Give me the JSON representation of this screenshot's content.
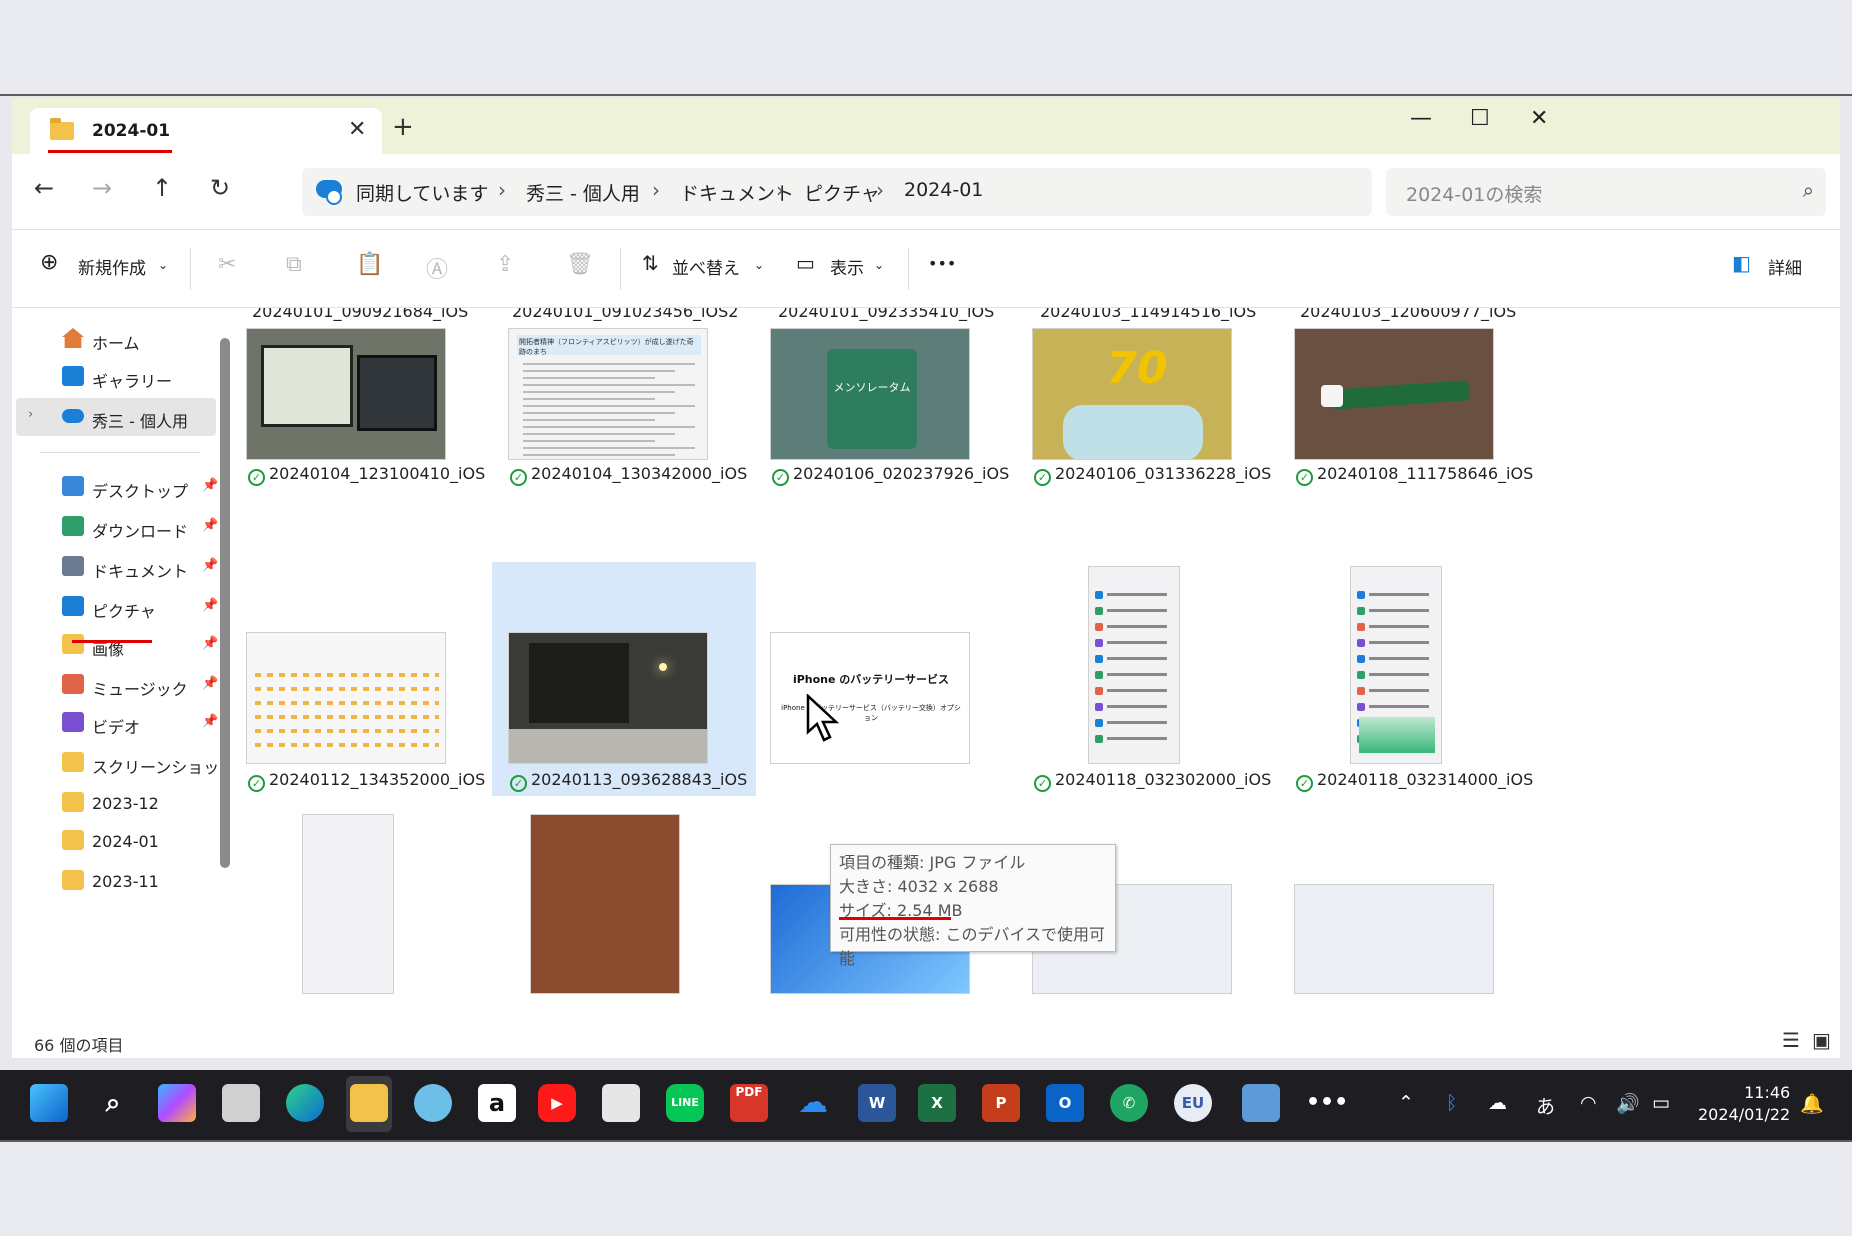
{
  "tab": {
    "title": "2024-01"
  },
  "address": {
    "crumbs": [
      "同期しています",
      "秀三 - 個人用",
      "ドキュメント",
      "ピクチャ",
      "2024-01"
    ]
  },
  "search": {
    "placeholder": "2024-01の検索"
  },
  "toolbar": {
    "new": "新規作成",
    "sort": "並べ替え",
    "view": "表示",
    "details": "詳細",
    "more": "•••"
  },
  "sidebar": {
    "home": "ホーム",
    "gallery": "ギャラリー",
    "onedrive": "秀三 - 個人用",
    "pinned": [
      {
        "label": "デスクトップ",
        "color": "#3a86d9"
      },
      {
        "label": "ダウンロード",
        "color": "#2e9e6a"
      },
      {
        "label": "ドキュメント",
        "color": "#6b7a90"
      },
      {
        "label": "ピクチャ",
        "color": "#1b7fd6"
      },
      {
        "label": "画像",
        "color": "#f3c24a"
      },
      {
        "label": "ミュージック",
        "color": "#e0634a"
      },
      {
        "label": "ビデオ",
        "color": "#7b4fd1"
      },
      {
        "label": "スクリーンショット",
        "color": "#f3c24a"
      },
      {
        "label": "2023-12",
        "color": "#f3c24a"
      },
      {
        "label": "2024-01",
        "color": "#f3c24a"
      },
      {
        "label": "2023-11",
        "color": "#f3c24a"
      }
    ]
  },
  "top_row": [
    "20240101_090921684_iOS",
    "20240101_091023456_iOS2",
    "20240101_092335410_iOS",
    "20240103_114914516_iOS",
    "20240103_120600977_iOS"
  ],
  "files": [
    {
      "name": "20240104_123100410_iOS",
      "color": "#6f7468"
    },
    {
      "name": "20240104_130342000_iOS",
      "color": "#f4f4f4"
    },
    {
      "name": "20240106_020237926_iOS",
      "color": "#5d7e78"
    },
    {
      "name": "20240106_031336228_iOS",
      "color": "#c8b258"
    },
    {
      "name": "20240108_111758646_iOS",
      "color": "#6a5041"
    },
    {
      "name": "20240112_134352000_iOS",
      "color": "#f7f7f7"
    },
    {
      "name": "20240113_093628843_iOS",
      "color": "#3a3a36"
    },
    {
      "name": "",
      "color": "#ffffff"
    },
    {
      "name": "20240118_032302000_iOS",
      "color": "#f2f2f4"
    },
    {
      "name": "20240118_032314000_iOS",
      "color": "#f2f2f4"
    }
  ],
  "thumb_texts": {
    "doc": "開拓者精神（フロンティアスピリッツ）が成し遂げた奇跡のまち",
    "battery": "iPhone のバッテリーサービス",
    "battery_sub": "iPhone のバッテリーサービス（バッテリー交換）オプション",
    "lip": "メンソレータム",
    "bag": "70"
  },
  "tooltip": {
    "type": "項目の種類: JPG ファイル",
    "dims": "大きさ: 4032 x 2688",
    "size": "サイズ: 2.54 MB",
    "avail": "可用性の状態: このデバイスで使用可能"
  },
  "status": {
    "count": "66 個の項目"
  },
  "clock": {
    "time": "11:46",
    "date": "2024/01/22"
  },
  "taskbar": [
    {
      "name": "pdf-png",
      "label": "PDF",
      "color": "#d9362b"
    },
    {
      "name": "eu",
      "label": "EU",
      "color": "#3a5aa8"
    }
  ]
}
